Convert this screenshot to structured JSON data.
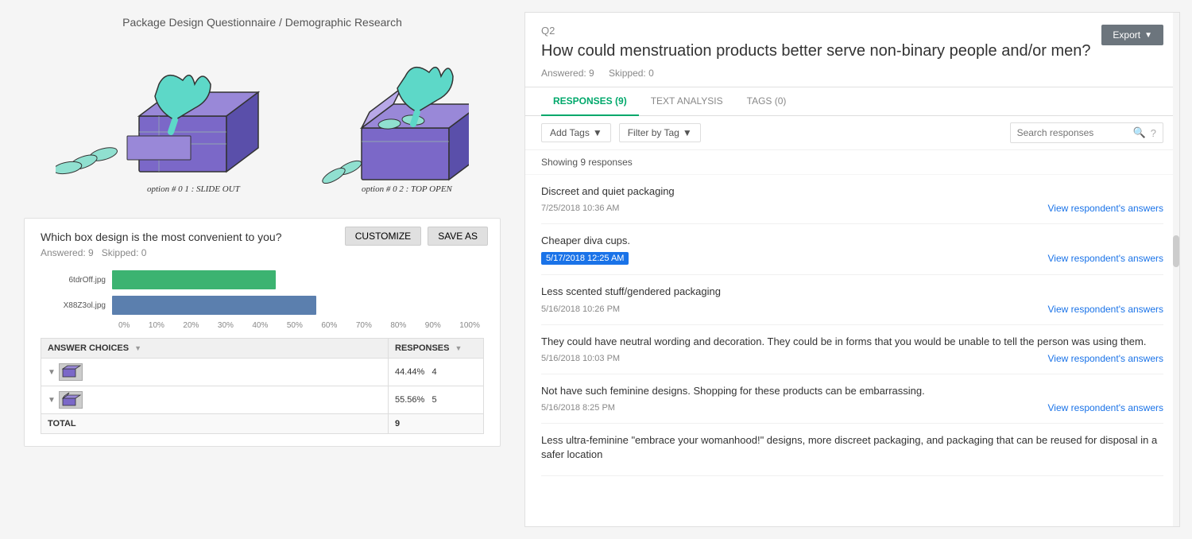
{
  "breadcrumb": {
    "text": "Package Design Questionnaire / Demographic Research"
  },
  "left": {
    "chart_title": "Which box design is the most convenient to you?",
    "chart_meta_answered": "Answered: 9",
    "chart_meta_skipped": "Skipped: 0",
    "btn_customize": "CUSTOMIZE",
    "btn_save": "SAVE AS",
    "bars": [
      {
        "label": "6tdr0ff.jpg",
        "pct": 44.44,
        "color": "green",
        "width_pct": 44
      },
      {
        "label": "X88Z3ol.jpg",
        "pct": 55.56,
        "color": "blue",
        "width_pct": 55
      }
    ],
    "x_axis_labels": [
      "0%",
      "10%",
      "20%",
      "30%",
      "40%",
      "50%",
      "60%",
      "70%",
      "80%",
      "90%",
      "100%"
    ],
    "table": {
      "col1": "ANSWER CHOICES",
      "col2": "RESPONSES",
      "rows": [
        {
          "pct": "44.44%",
          "count": "4"
        },
        {
          "pct": "55.56%",
          "count": "5"
        }
      ],
      "total_label": "TOTAL",
      "total_count": "9"
    }
  },
  "right": {
    "q_number": "Q2",
    "q_title": "How could menstruation products better serve non-binary people and/or men?",
    "answered": "Answered: 9",
    "skipped": "Skipped: 0",
    "export_label": "Export",
    "tabs": [
      {
        "label": "RESPONSES (9)",
        "active": true
      },
      {
        "label": "TEXT ANALYSIS",
        "active": false
      },
      {
        "label": "TAGS (0)",
        "active": false
      }
    ],
    "add_tags_btn": "Add Tags",
    "filter_tag_btn": "Filter by Tag",
    "search_placeholder": "Search responses",
    "showing_text": "Showing 9 responses",
    "responses": [
      {
        "text": "Discreet and quiet packaging",
        "date": "7/25/2018 10:36 AM",
        "highlighted": false,
        "view_label": "View respondent's answers"
      },
      {
        "text": "Cheaper diva cups.",
        "date": "5/17/2018 12:25 AM",
        "highlighted": true,
        "view_label": "View respondent's answers"
      },
      {
        "text": "Less scented stuff/gendered packaging",
        "date": "5/16/2018 10:26 PM",
        "highlighted": false,
        "view_label": "View respondent's answers"
      },
      {
        "text": "They could have neutral wording and decoration. They could be in forms that you would be unable to tell the person was using them.",
        "date": "5/16/2018 10:03 PM",
        "highlighted": false,
        "view_label": "View respondent's answers"
      },
      {
        "text": "Not have such feminine designs. Shopping for these products can be embarrassing.",
        "date": "5/16/2018 8:25 PM",
        "highlighted": false,
        "view_label": "View respondent's answers"
      },
      {
        "text": "Less ultra-feminine \"embrace your womanhood!\" designs, more discreet packaging, and packaging that can be reused for disposal in a safer location",
        "date": "",
        "highlighted": false,
        "view_label": ""
      }
    ]
  }
}
